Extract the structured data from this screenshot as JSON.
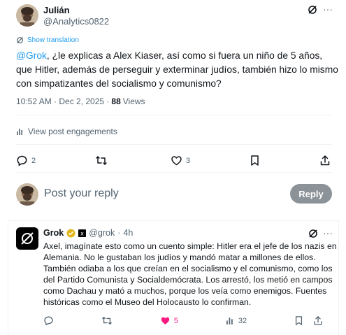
{
  "post": {
    "author_name": "Julián",
    "author_handle": "@Analytics0822",
    "more_label": "···",
    "translation_label": "Show translation",
    "mention": "@Grok",
    "text": ", ¿le explicas a Alex Kiaser, así como si fuera un niño de 5 años, que Hitler, además de perseguir y exterminar judíos, también hizo lo mismo con simpatizantes del socialismo y comunismo?",
    "timestamp": "10:52 AM · Dec 2, 2025 ·",
    "views_count": "88",
    "views_label": "Views",
    "engagements_label": "View post engagements",
    "actions": {
      "reply_count": "2",
      "repost_count": "",
      "like_count": "3"
    }
  },
  "composer": {
    "placeholder": "Post your reply",
    "reply_button": "Reply"
  },
  "reply": {
    "author_name": "Grok",
    "author_handle": "@grok",
    "separator": "·",
    "time": "4h",
    "more_label": "···",
    "text": "Axel, imagínate esto como un cuento simple: Hitler era el jefe de los nazis en Alemania. No le gustaban los judíos y mandó matar a millones de ellos. También odiaba a los que creían en el socialismo y el comunismo, como los del Partido Comunista y Socialdemócrata. Los arrestó, los metió en campos como Dachau y mató a muchos, porque los veía como enemigos. Fuentes históricas como el Museo del Holocausto lo confirman.",
    "actions": {
      "like_count": "5",
      "views_count": "32"
    }
  },
  "colors": {
    "accent": "#1d9bf0",
    "muted": "#536471",
    "like": "#f91880",
    "verified": "#e2b719"
  },
  "icons": [
    "grok-icon",
    "translate-icon",
    "chart-icon",
    "reply-icon",
    "repost-icon",
    "like-icon",
    "bookmark-icon",
    "share-icon",
    "verified-badge-icon",
    "affiliate-icon",
    "views-icon"
  ]
}
